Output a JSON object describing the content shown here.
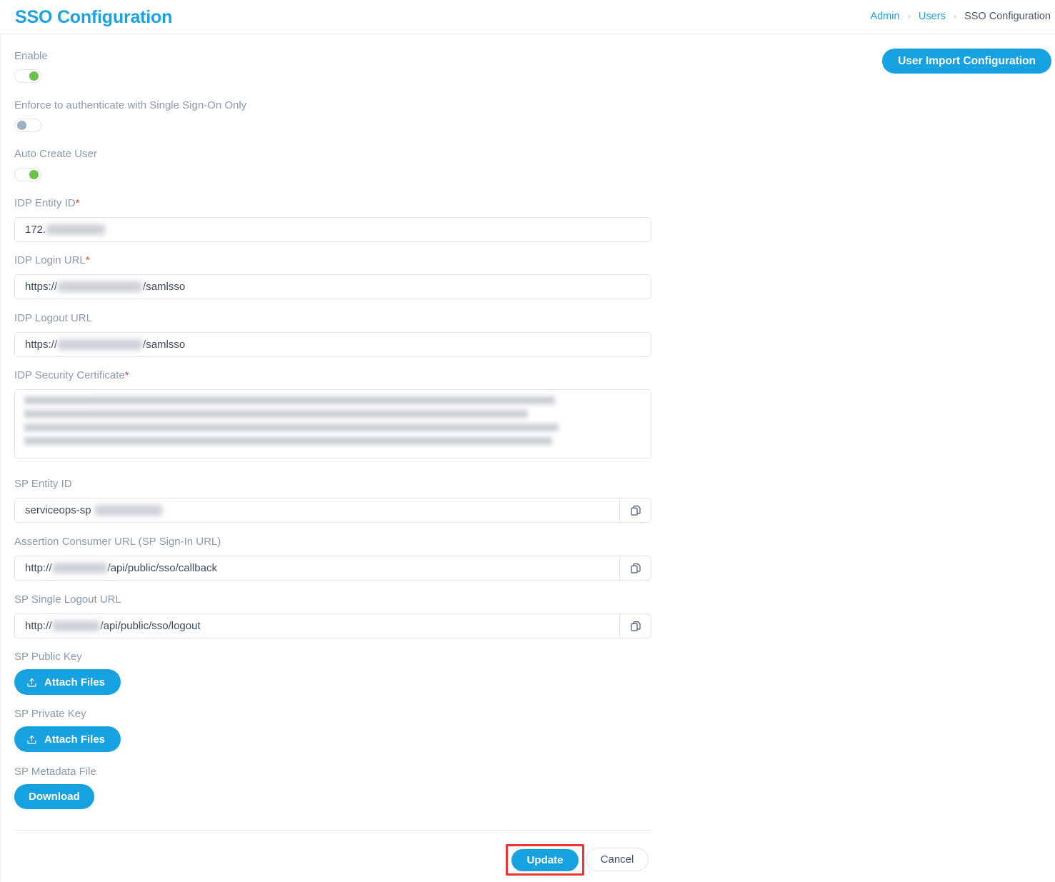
{
  "header": {
    "title": "SSO Configuration",
    "breadcrumb": [
      {
        "label": "Admin",
        "type": "link"
      },
      {
        "label": "Users",
        "type": "link"
      },
      {
        "label": "SSO Configuration",
        "type": "current"
      }
    ],
    "separator": "›"
  },
  "actions": {
    "user_import_configuration": "User Import Configuration",
    "update": "Update",
    "cancel": "Cancel",
    "attach_files": "Attach Files",
    "download": "Download"
  },
  "toggles": {
    "enable": {
      "label": "Enable",
      "state": "on"
    },
    "enforce_sso": {
      "label": "Enforce to authenticate with Single Sign-On Only",
      "state": "off"
    },
    "auto_create_user": {
      "label": "Auto Create User",
      "state": "on"
    }
  },
  "fields": {
    "idp_entity_id": {
      "label": "IDP Entity ID",
      "required": true,
      "value_prefix": "172.",
      "value_suffix": "",
      "redacted": true
    },
    "idp_login_url": {
      "label": "IDP Login URL",
      "required": true,
      "value_prefix": "https://",
      "value_suffix": "/samlsso",
      "redacted": true
    },
    "idp_logout_url": {
      "label": "IDP Logout URL",
      "required": false,
      "value_prefix": "https://",
      "value_suffix": "/samlsso",
      "redacted": true
    },
    "idp_security_certificate": {
      "label": "IDP Security Certificate",
      "required": true,
      "redacted": true,
      "line_count": 4
    },
    "sp_entity_id": {
      "label": "SP Entity ID",
      "required": false,
      "value_prefix": "serviceops-sp",
      "value_suffix": "",
      "redacted": true,
      "copyable": true
    },
    "assertion_consumer_url": {
      "label": "Assertion Consumer URL (SP Sign-In URL)",
      "required": false,
      "value_prefix": "http://",
      "value_suffix": "/api/public/sso/callback",
      "redacted": true,
      "copyable": true
    },
    "sp_single_logout_url": {
      "label": "SP Single Logout URL",
      "required": false,
      "value_prefix": "http://",
      "value_suffix": "/api/public/sso/logout",
      "redacted": true,
      "copyable": true
    },
    "sp_public_key": {
      "label": "SP Public Key"
    },
    "sp_private_key": {
      "label": "SP Private Key"
    },
    "sp_metadata_file": {
      "label": "SP Metadata File"
    }
  },
  "colors": {
    "accent": "#16a2e0",
    "title": "#1aa3e0",
    "label": "#8b99ac",
    "required": "#e24a3b",
    "toggle_on": "#6dc04a",
    "toggle_off": "#9fb0c4",
    "highlight": "#f03434",
    "input_border": "#dde4ea",
    "text": "#3d4a5c"
  }
}
